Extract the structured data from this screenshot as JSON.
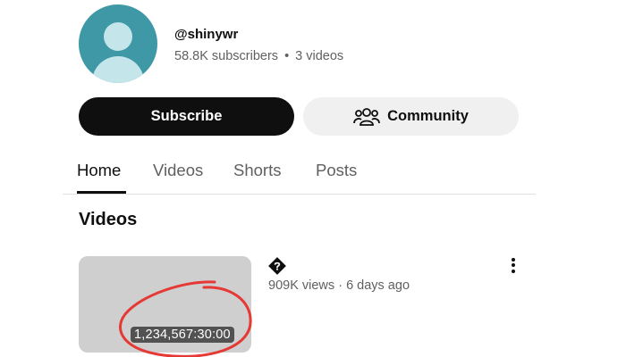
{
  "channel": {
    "handle": "@shinywr",
    "subscribers": "58.8K subscribers",
    "separator": "•",
    "video_count": "3 videos"
  },
  "buttons": {
    "subscribe": "Subscribe",
    "community": "Community"
  },
  "tabs": [
    {
      "label": "Home",
      "active": true
    },
    {
      "label": "Videos",
      "active": false
    },
    {
      "label": "Shorts",
      "active": false
    },
    {
      "label": "Posts",
      "active": false
    }
  ],
  "section": {
    "title": "Videos"
  },
  "video": {
    "duration": "1,234,567:30:00",
    "views": "909K views",
    "separator": "·",
    "age": "6 days ago"
  },
  "colors": {
    "avatar_bg": "#3f98a6",
    "annotation_circle": "#e53935"
  },
  "icons": [
    "avatar-icon",
    "community-icon",
    "unknown-glyph-icon",
    "more-vert-icon"
  ]
}
